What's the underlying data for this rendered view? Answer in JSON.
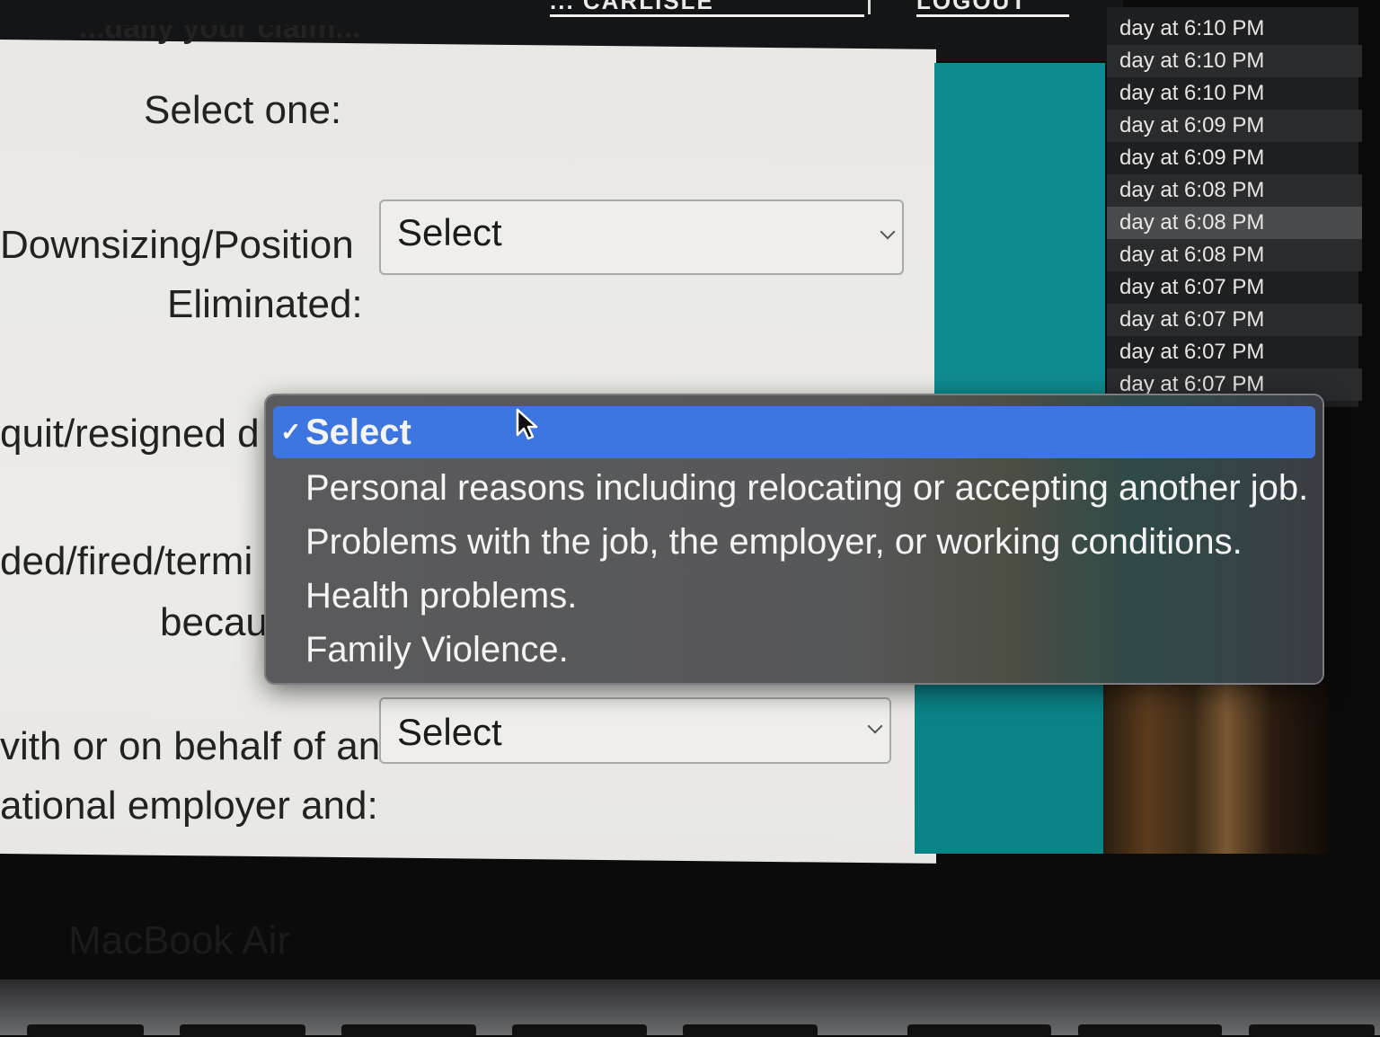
{
  "header": {
    "nav_link_1": "... CARLISLE",
    "nav_link_2": "LOGOUT",
    "partial_heading": "...daily your claim..."
  },
  "form": {
    "select_one_label": "Select one:",
    "downsizing_label_line1": "Downsizing/Position",
    "downsizing_label_line2": "Eliminated:",
    "quit_label": "quit/resigned d",
    "fired_label_line1": "ded/fired/termi",
    "fired_label_line2": "becau",
    "behalf_label_line1": "vith or on behalf of an",
    "behalf_label_line2": "ational employer and:",
    "select_downsizing_value": "Select",
    "select_behalf_value": "Select"
  },
  "dropdown": {
    "options": [
      "Select",
      "Personal reasons including relocating or accepting another job.",
      "Problems with the job, the employer, or working conditions.",
      "Health problems.",
      "Family Violence."
    ],
    "selected_index": 0,
    "check_glyph": "✓"
  },
  "notifications": [
    "day at 6:10 PM",
    "day at 6:10 PM",
    "day at 6:10 PM",
    "day at 6:09 PM",
    "day at 6:09 PM",
    "day at 6:08 PM",
    "day at 6:08 PM",
    "day at 6:08 PM",
    "day at 6:07 PM",
    "day at 6:07 PM",
    "day at 6:07 PM",
    "day at 6:07 PM"
  ],
  "bezel": {
    "brand": "MacBook Air"
  },
  "colors": {
    "accent": "#3d76e0",
    "teal": "#0e8b8f",
    "panel": "#ebeae6"
  }
}
